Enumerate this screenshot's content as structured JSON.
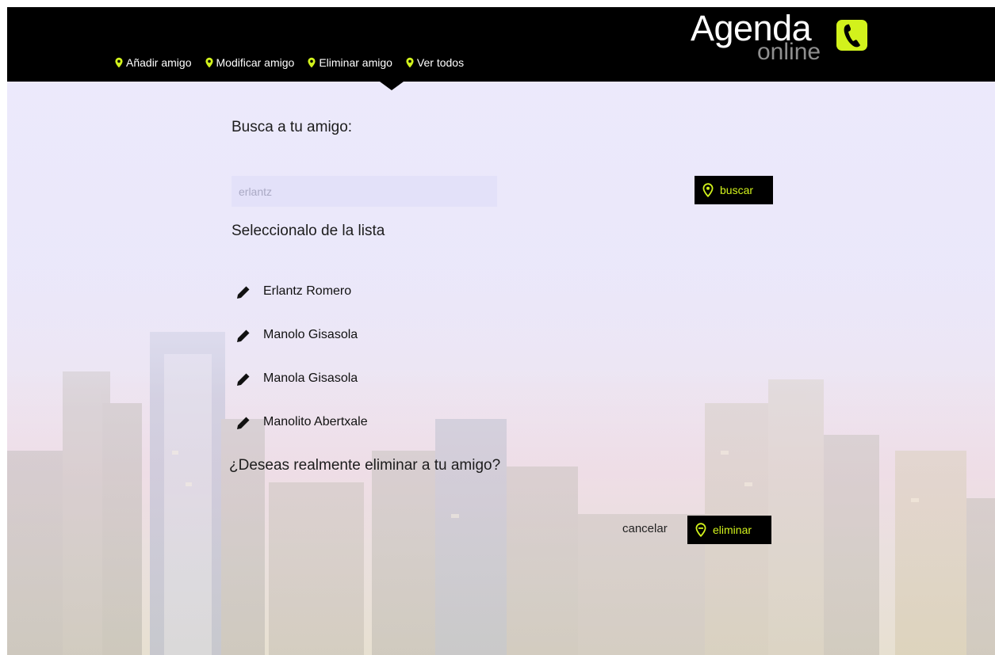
{
  "nav": {
    "items": [
      {
        "label": "Añadir amigo"
      },
      {
        "label": "Modificar amigo"
      },
      {
        "label": "Eliminar amigo"
      },
      {
        "label": "Ver todos"
      }
    ],
    "active": "Eliminar amigo"
  },
  "logo": {
    "title": "Agenda",
    "subtitle": "online",
    "icon": "phone-icon",
    "accent_color": "#d2f21c"
  },
  "search": {
    "title": "Busca a tu amigo:",
    "placeholder": "erlantz",
    "value": "",
    "button_label": "buscar"
  },
  "list": {
    "title": "Seleccionalo de la lista",
    "items": [
      {
        "name": "Erlantz Romero",
        "icon": "pencil-icon"
      },
      {
        "name": "Manolo Gisasola",
        "icon": "pencil-icon"
      },
      {
        "name": "Manola Gisasola",
        "icon": "pencil-icon"
      },
      {
        "name": "Manolito Abertxale",
        "icon": "pencil-icon"
      }
    ]
  },
  "confirm": {
    "question": "¿Deseas realmente eliminar a tu amigo?",
    "cancel_label": "cancelar",
    "delete_label": "eliminar"
  },
  "colors": {
    "header_bg": "#000000",
    "accent": "#d2f21c",
    "text": "#1c1c1c"
  }
}
